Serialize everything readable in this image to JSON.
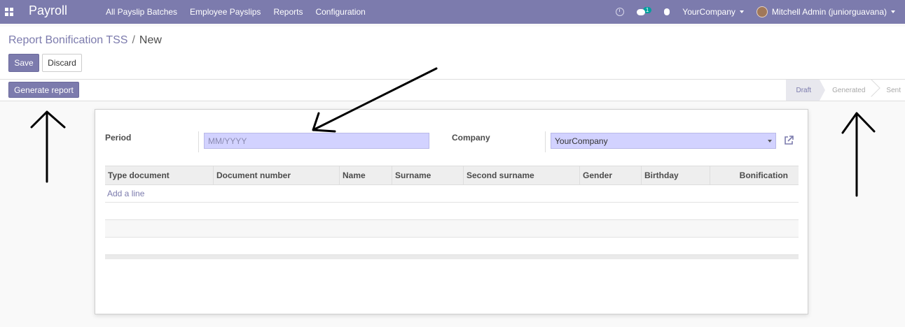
{
  "navbar": {
    "app_name": "Payroll",
    "menu": [
      "All Payslip Batches",
      "Employee Payslips",
      "Reports",
      "Configuration"
    ],
    "messages_badge": "1",
    "company": "YourCompany",
    "user": "Mitchell Admin (juniorguavana)"
  },
  "breadcrumb": {
    "parent": "Report Bonification TSS",
    "separator": "/",
    "current": "New"
  },
  "buttons": {
    "save": "Save",
    "discard": "Discard",
    "generate_report": "Generate report"
  },
  "statusbar": {
    "steps": [
      "Draft",
      "Generated",
      "Sent"
    ],
    "active_step": "Draft"
  },
  "form": {
    "period_label": "Period",
    "period_placeholder": "MM/YYYY",
    "period_value": "",
    "company_label": "Company",
    "company_value": "YourCompany"
  },
  "table": {
    "columns": [
      "Type document",
      "Document number",
      "Name",
      "Surname",
      "Second surname",
      "Gender",
      "Birthday",
      "Bonification"
    ],
    "add_line": "Add a line"
  },
  "colors": {
    "brand": "#7c7bad",
    "input_bg": "#d2d2ff",
    "badge": "#00a09d"
  },
  "icons": [
    "apps-grid-icon",
    "clock-icon",
    "chat-icon",
    "bug-icon",
    "external-link-icon"
  ]
}
